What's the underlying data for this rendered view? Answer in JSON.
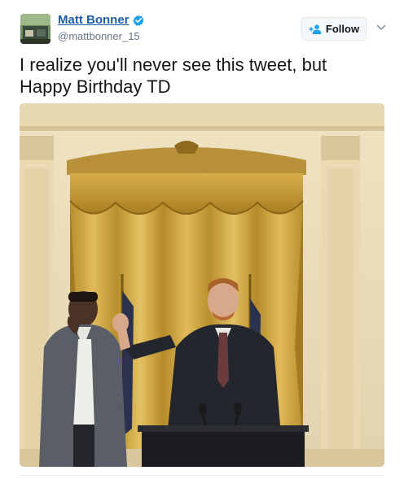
{
  "user": {
    "display_name": "Matt Bonner",
    "handle": "@mattbonner_15",
    "verified": true
  },
  "follow_button": {
    "label": "Follow"
  },
  "tweet": {
    "text_line1": "I realize you'll never see this tweet, but",
    "text_line2": "Happy Birthday TD"
  },
  "icons": {
    "verified": "verified-badge-icon",
    "follow": "person-plus-icon",
    "menu": "chevron-down-icon"
  },
  "colors": {
    "name_link": "#1b5fa8",
    "verified_badge": "#1da1f2",
    "follow_icon": "#1da1f2",
    "handle": "#657786",
    "text": "#14171a"
  }
}
